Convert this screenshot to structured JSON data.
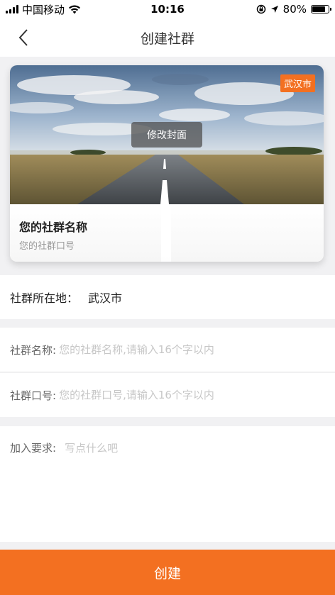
{
  "status_bar": {
    "carrier": "中国移动",
    "time": "10:16",
    "battery": "80%",
    "battery_level": 0.8
  },
  "nav": {
    "title": "创建社群",
    "back_icon": "chevron-left-icon"
  },
  "card": {
    "city_badge": "武汉市",
    "edit_cover_label": "修改封面",
    "name_preview": "您的社群名称",
    "slogan_preview": "您的社群口号"
  },
  "location": {
    "label": "社群所在地：",
    "value": "武汉市"
  },
  "form": {
    "name_label": "社群名称:",
    "name_placeholder": "您的社群名称,请输入16个字以内",
    "slogan_label": "社群口号:",
    "slogan_placeholder": "您的社群口号,请输入16个字以内",
    "requirement_label": "加入要求:",
    "requirement_placeholder": "写点什么吧"
  },
  "submit_label": "创建",
  "colors": {
    "accent": "#f37021",
    "background": "#f1f1f3"
  }
}
